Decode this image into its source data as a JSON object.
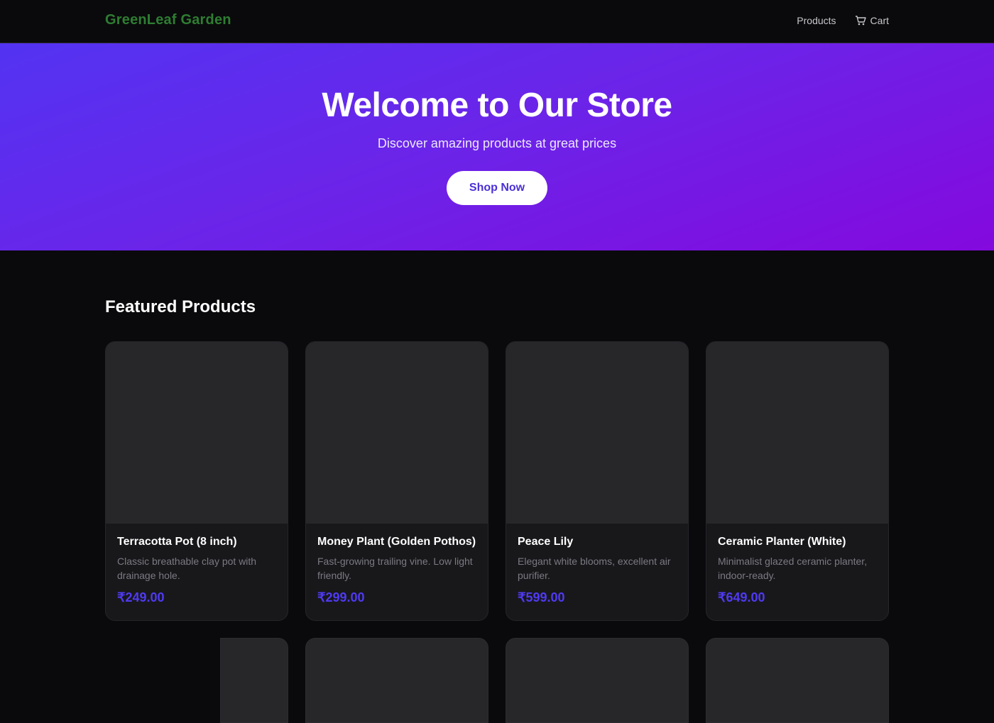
{
  "navbar": {
    "brand": "GreenLeaf Garden",
    "links": [
      {
        "label": "Products",
        "icon": null
      },
      {
        "label": "Cart",
        "icon": "cart-icon"
      }
    ]
  },
  "hero": {
    "title": "Welcome to Our Store",
    "subtitle": "Discover amazing products at great prices",
    "cta_label": "Shop Now"
  },
  "featured": {
    "title": "Featured Products",
    "products": [
      {
        "name": "Terracotta Pot (8 inch)",
        "description": "Classic breathable clay pot with drainage hole.",
        "price": "₹249.00"
      },
      {
        "name": "Money Plant (Golden Pothos)",
        "description": "Fast-growing trailing vine. Low light friendly.",
        "price": "₹299.00"
      },
      {
        "name": "Peace Lily",
        "description": "Elegant white blooms, excellent air purifier.",
        "price": "₹599.00"
      },
      {
        "name": "Ceramic Planter (White)",
        "description": "Minimalist glazed ceramic planter, indoor-ready.",
        "price": "₹649.00"
      }
    ]
  },
  "colors": {
    "brand": "#2e7d32",
    "accent": "#4f3af2",
    "hero_gradient_start": "#5333f2",
    "hero_gradient_end": "#8409de",
    "background": "#0a0a0c",
    "card": "#18181b"
  }
}
